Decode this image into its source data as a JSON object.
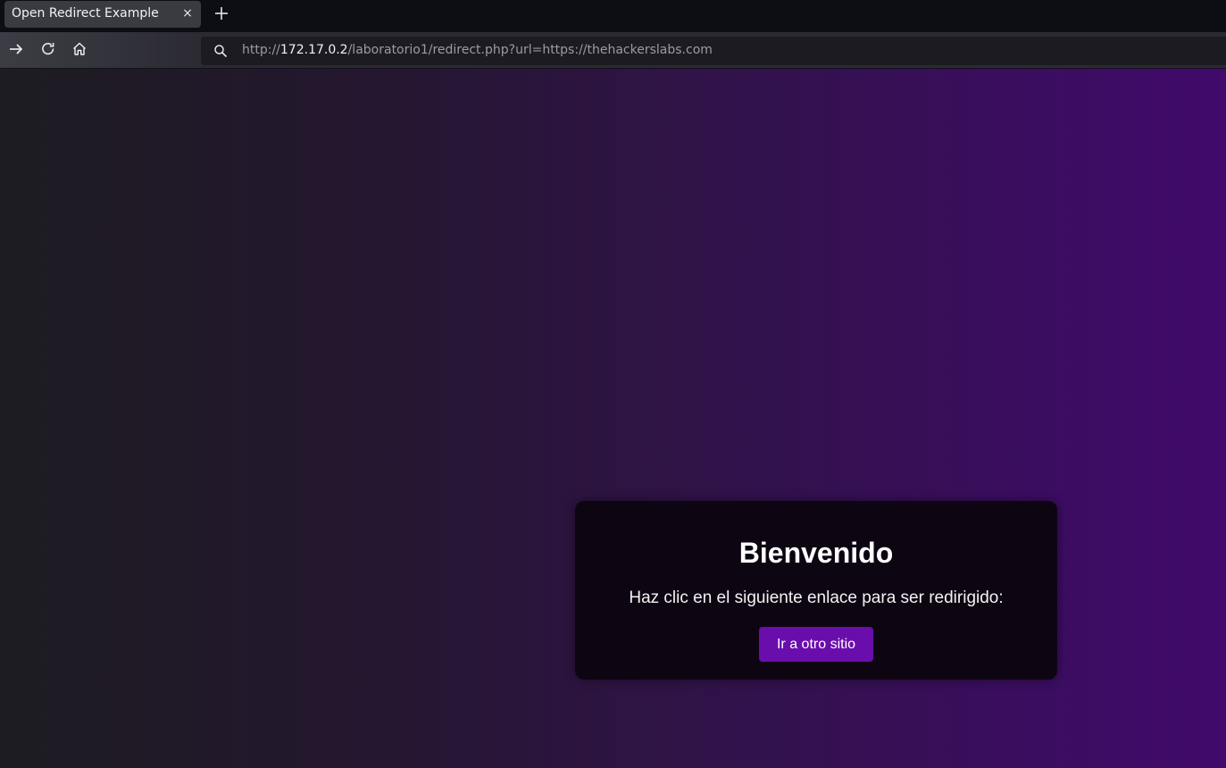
{
  "tab": {
    "title": "Open Redirect Example",
    "close_symbol": "×"
  },
  "icons": {
    "new_tab": "plus-icon",
    "forward": "forward-arrow-icon",
    "reload": "reload-icon",
    "home": "home-icon",
    "search": "search-icon"
  },
  "urlbar": {
    "prefix": "http://",
    "host": "172.17.0.2",
    "path": "/laboratorio1/redirect.php?url=https://thehackerslabs.com"
  },
  "page": {
    "heading": "Bienvenido",
    "message": "Haz clic en el siguiente enlace para ser redirigido:",
    "button_label": "Ir a otro sitio"
  },
  "colors": {
    "button": "#6a0dad",
    "card": "#0d0612",
    "gradient_end": "#410a6b"
  }
}
